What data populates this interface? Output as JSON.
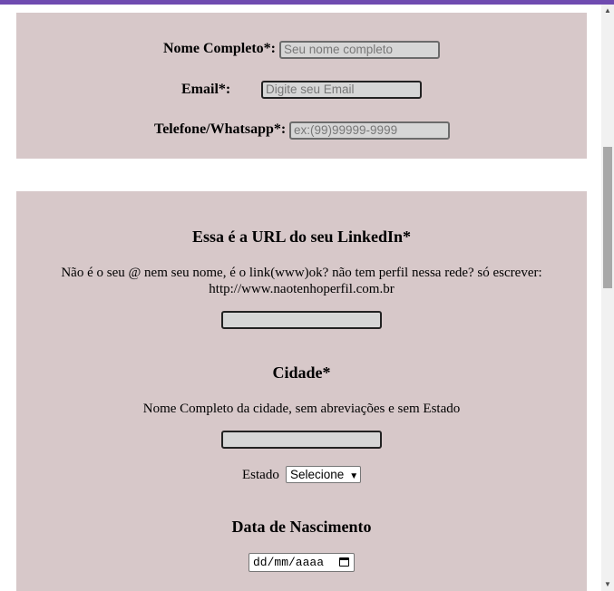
{
  "contact": {
    "name_label": "Nome Completo*:",
    "name_placeholder": "Seu nome completo",
    "email_label": "Email*:",
    "email_placeholder": "Digite seu Email",
    "phone_label": "Telefone/Whatsapp*:",
    "phone_placeholder": "ex:(99)99999-9999"
  },
  "linkedin": {
    "heading": "Essa é a URL do seu LinkedIn*",
    "desc_line1": "Não é o seu @ nem seu nome, é o link(www)ok? não tem perfil nessa rede? só escrever:",
    "desc_line2": "http://www.naotenhoperfil.com.br",
    "value": ""
  },
  "city": {
    "heading": "Cidade*",
    "desc": "Nome Completo da cidade, sem abreviações e sem Estado",
    "value": "",
    "state_label": "Estado",
    "state_selected": "Selecione"
  },
  "birth": {
    "heading": "Data de Nascimento",
    "date_placeholder": "dd/mm/aaaa"
  },
  "icons": {
    "dropdown": "chevron-down-icon",
    "calendar": "calendar-icon",
    "scroll_up": "arrow-up-icon",
    "scroll_down": "arrow-down-icon"
  },
  "colors": {
    "accent": "#6f4bb0",
    "panel": "#d7c8c9"
  }
}
